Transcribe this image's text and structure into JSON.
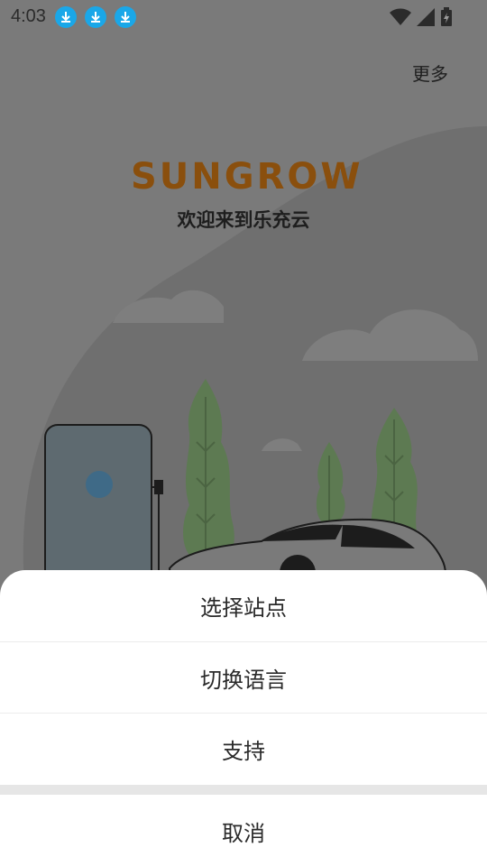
{
  "status_bar": {
    "time": "4:03",
    "download_icons": [
      "download-icon",
      "download-icon",
      "download-icon"
    ],
    "right_icons": [
      "wifi-icon",
      "signal-icon",
      "battery-charging-icon"
    ]
  },
  "header": {
    "more_label": "更多"
  },
  "brand": {
    "logo_text": "SUNGROW",
    "welcome": "欢迎来到乐充云"
  },
  "sheet": {
    "items": [
      {
        "label": "选择站点"
      },
      {
        "label": "切换语言"
      },
      {
        "label": "支持"
      }
    ],
    "cancel_label": "取消"
  },
  "colors": {
    "overlay_bg": "#7a7a7a",
    "logo": "#8a4f0d",
    "download_badge": "#1aa7e8",
    "tree": "#5d7a52"
  }
}
